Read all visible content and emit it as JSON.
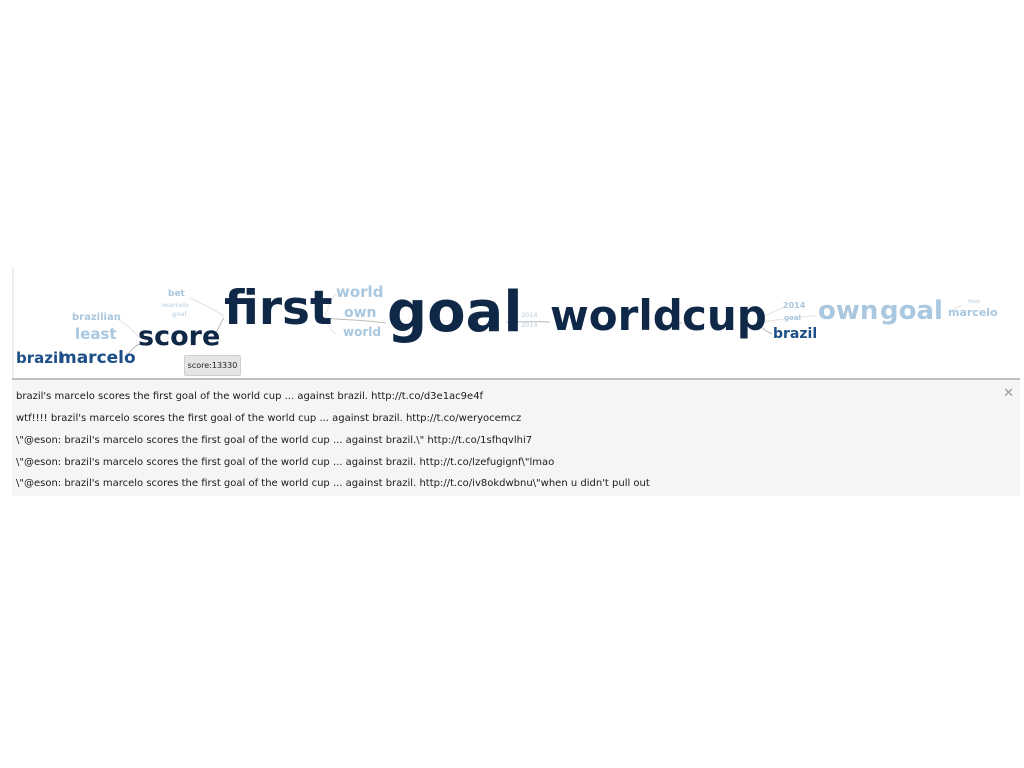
{
  "word_tree": {
    "words": [
      {
        "id": "brazil_l",
        "text": "brazil",
        "tone": "mid"
      },
      {
        "id": "marcelo_l",
        "text": "marcelo",
        "tone": "mid"
      },
      {
        "id": "brazilian",
        "text": "brazilian",
        "tone": "lite"
      },
      {
        "id": "least",
        "text": "least",
        "tone": "lite"
      },
      {
        "id": "bet",
        "text": "bet",
        "tone": "lite"
      },
      {
        "id": "marcelo_s",
        "text": "marcelo",
        "tone": "vlite"
      },
      {
        "id": "goal_s",
        "text": "goal",
        "tone": "vlite"
      },
      {
        "id": "score",
        "text": "score",
        "tone": "dark"
      },
      {
        "id": "first",
        "text": "first",
        "tone": "dark"
      },
      {
        "id": "world1",
        "text": "world",
        "tone": "lite"
      },
      {
        "id": "own1",
        "text": "own",
        "tone": "lite"
      },
      {
        "id": "world2",
        "text": "world",
        "tone": "lite"
      },
      {
        "id": "goal",
        "text": "goal",
        "tone": "dark"
      },
      {
        "id": "y2014a",
        "text": "2014",
        "tone": "vlite"
      },
      {
        "id": "y2014b",
        "text": "2014",
        "tone": "vlite"
      },
      {
        "id": "world",
        "text": "world",
        "tone": "dark"
      },
      {
        "id": "cup",
        "text": "cup",
        "tone": "dark"
      },
      {
        "id": "y2014c",
        "text": "2014",
        "tone": "lite"
      },
      {
        "id": "goal_s2",
        "text": "goal",
        "tone": "lite"
      },
      {
        "id": "brazil_r",
        "text": "brazil",
        "tone": "mid"
      },
      {
        "id": "own_r",
        "text": "own",
        "tone": "lite"
      },
      {
        "id": "goal_r",
        "text": "goal",
        "tone": "lite"
      },
      {
        "id": "marcelo_r",
        "text": "marcelo",
        "tone": "lite"
      },
      {
        "id": "tiny_r",
        "text": "that",
        "tone": "vlite"
      }
    ],
    "tooltip": "score:13330"
  },
  "tweets": {
    "items": [
      "brazil's marcelo scores the first goal of the world cup ... against brazil. http://t.co/d3e1ac9e4f",
      "wtf!!!! brazil's marcelo scores the first goal of the world cup ... against brazil. http://t.co/weryocemcz",
      "\\\"@eson: brazil's marcelo scores the first goal of the world cup ... against brazil.\\\" http://t.co/1sfhqvlhi7",
      "\\\"@eson: brazil's marcelo scores the first goal of the world cup ... against brazil. http://t.co/lzefugignf\\\"lmao",
      "\\\"@eson: brazil's marcelo scores the first goal of the world cup ... against brazil. http://t.co/iv8okdwbnu\\\"when u didn't pull out"
    ],
    "close_icon": "close-icon"
  }
}
